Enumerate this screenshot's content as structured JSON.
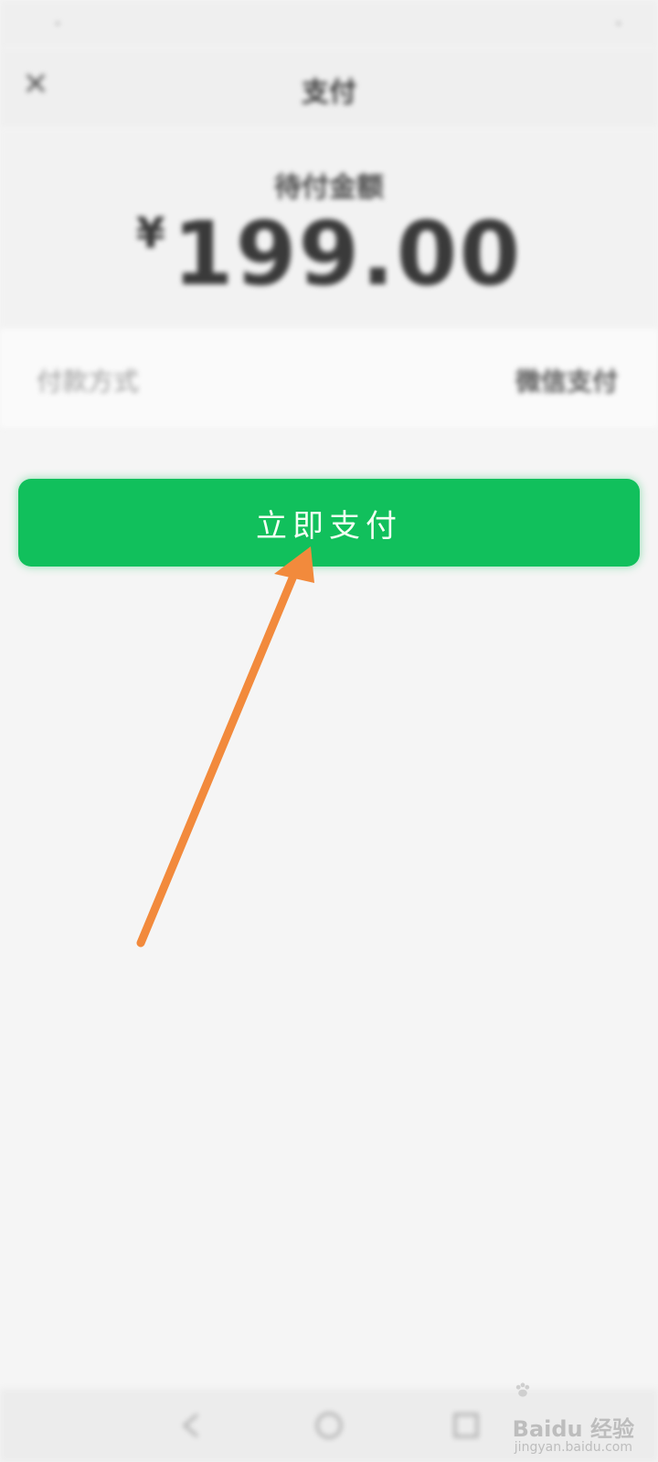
{
  "status_bar": {
    "left": "·",
    "right": "·"
  },
  "nav": {
    "title": "支付",
    "close_icon": "close-icon"
  },
  "amount": {
    "label": "待付金额",
    "currency": "¥",
    "value": "199.00"
  },
  "method": {
    "label": "付款方式",
    "value": "微信支付"
  },
  "pay_button": {
    "label": "立即支付",
    "color": "#11c05c"
  },
  "annotation": {
    "arrow_color": "#f28a3c"
  },
  "footer": {
    "text": ""
  },
  "bottom_nav": {
    "back_icon": "back-icon",
    "home_icon": "home-icon",
    "recent_icon": "recent-icon"
  },
  "watermark": {
    "logo": "Baidu",
    "text": "经验",
    "sub": "jingyan.baidu.com"
  }
}
